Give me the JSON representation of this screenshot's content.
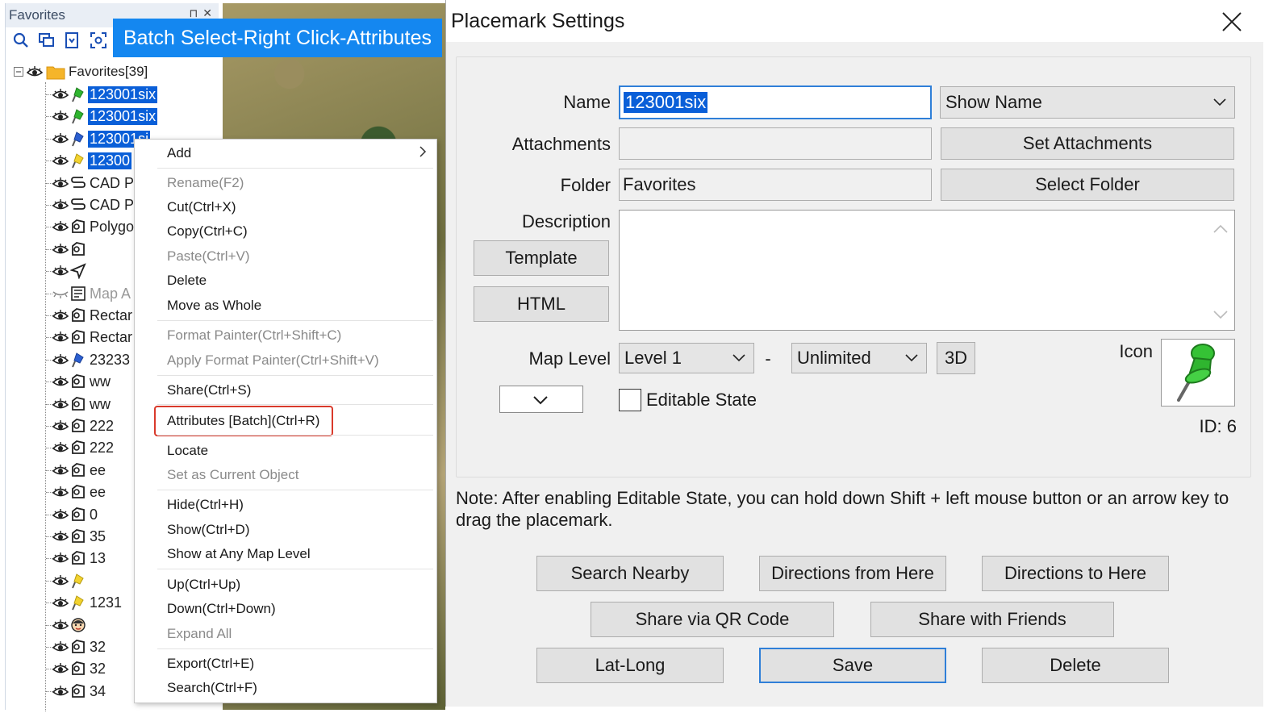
{
  "favorites": {
    "title": "Favorites",
    "header_controls": [
      "⊓",
      "✕"
    ],
    "root_label": "Favorites[39]",
    "items": [
      {
        "label": "123001six",
        "icon": "green-pin-icon",
        "selected": true
      },
      {
        "label": "123001six",
        "icon": "green-pin-icon",
        "selected": true
      },
      {
        "label": "123001si",
        "icon": "blue-pin-icon",
        "selected": true
      },
      {
        "label": "12300",
        "icon": "yellow-pin-icon",
        "selected": true
      },
      {
        "label": "CAD P",
        "icon": "polyline-icon"
      },
      {
        "label": "CAD P",
        "icon": "polyline-icon"
      },
      {
        "label": "Polygo",
        "icon": "polygon-icon"
      },
      {
        "label": "",
        "icon": "polygon-icon"
      },
      {
        "label": "",
        "icon": "navigation-icon"
      },
      {
        "label": "Map A",
        "icon": "map-annotation-icon",
        "hidden": true
      },
      {
        "label": "Rectar",
        "icon": "polygon-icon"
      },
      {
        "label": "Rectar",
        "icon": "polygon-icon"
      },
      {
        "label": "23233",
        "icon": "blue-pin-icon"
      },
      {
        "label": "ww",
        "icon": "polygon-icon"
      },
      {
        "label": "ww",
        "icon": "polygon-icon"
      },
      {
        "label": "222",
        "icon": "polygon-icon"
      },
      {
        "label": "222",
        "icon": "polygon-icon"
      },
      {
        "label": "ee",
        "icon": "polygon-icon"
      },
      {
        "label": "ee",
        "icon": "polygon-icon"
      },
      {
        "label": "0",
        "icon": "polygon-icon"
      },
      {
        "label": "35",
        "icon": "polygon-icon"
      },
      {
        "label": "13",
        "icon": "polygon-icon"
      },
      {
        "label": "",
        "icon": "yellow-pin-icon"
      },
      {
        "label": "1231",
        "icon": "yellow-pin-icon"
      },
      {
        "label": "",
        "icon": "face-icon"
      },
      {
        "label": "32",
        "icon": "polygon-icon"
      },
      {
        "label": "32",
        "icon": "polygon-icon"
      },
      {
        "label": "34",
        "icon": "polygon-icon"
      }
    ]
  },
  "banner": {
    "text": "Batch Select-Right Click-Attributes"
  },
  "context_menu": {
    "add": "Add",
    "rename": "Rename(F2)",
    "cut": "Cut(Ctrl+X)",
    "copy": "Copy(Ctrl+C)",
    "paste": "Paste(Ctrl+V)",
    "delete": "Delete",
    "move_whole": "Move as Whole",
    "format_painter": "Format Painter(Ctrl+Shift+C)",
    "apply_format_painter": "Apply Format Painter(Ctrl+Shift+V)",
    "share": "Share(Ctrl+S)",
    "attributes_batch": "Attributes [Batch](Ctrl+R)",
    "locate": "Locate",
    "set_current": "Set as Current Object",
    "hide": "Hide(Ctrl+H)",
    "show": "Show(Ctrl+D)",
    "show_any_level": "Show at Any Map Level",
    "up": "Up(Ctrl+Up)",
    "down": "Down(Ctrl+Down)",
    "expand_all": "Expand All",
    "export": "Export(Ctrl+E)",
    "search": "Search(Ctrl+F)"
  },
  "dialog": {
    "title": "Placemark Settings",
    "name_label": "Name",
    "name_value": "123001six",
    "show_name": "Show Name",
    "attachments_label": "Attachments",
    "attachments_value": "",
    "set_attachments": "Set Attachments",
    "folder_label": "Folder",
    "folder_value": "Favorites",
    "select_folder": "Select Folder",
    "description_label": "Description",
    "template_button": "Template",
    "html_button": "HTML",
    "map_level_label": "Map Level",
    "level_from": "Level 1",
    "level_dash": "-",
    "level_to": "Unlimited",
    "btn_3d": "3D",
    "icon_label": "Icon",
    "editable_state": "Editable State",
    "id_text": "ID: 6",
    "note": "Note: After enabling Editable State, you can hold down Shift + left mouse button or an arrow key to drag the placemark.",
    "search_nearby": "Search Nearby",
    "directions_from": "Directions from Here",
    "directions_to": "Directions to Here",
    "share_qr": "Share via QR Code",
    "share_friends": "Share with Friends",
    "lat_long": "Lat-Long",
    "save": "Save",
    "delete": "Delete"
  },
  "colors": {
    "selection_blue": "#0a5fd8",
    "banner_blue": "#1487f0",
    "highlight_red": "#d93a2b",
    "pin_green": "#2fb52f",
    "focus_blue": "#2f7fd8"
  }
}
